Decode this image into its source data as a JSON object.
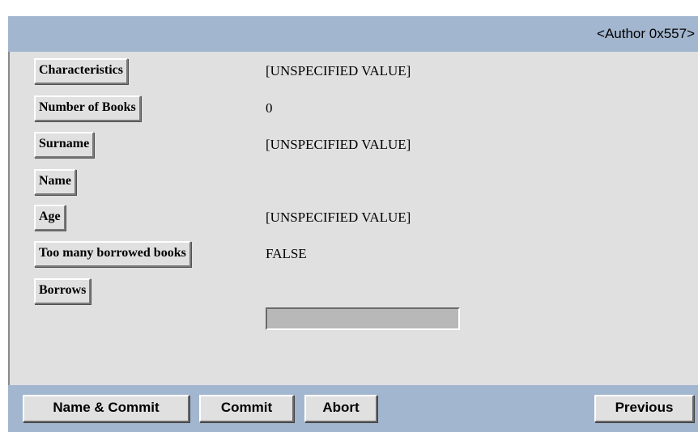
{
  "window": {
    "title": "<Author 0x557>"
  },
  "attributes": [
    {
      "label": "Characteristics",
      "value": "[UNSPECIFIED VALUE]"
    },
    {
      "label": "Number of Books",
      "value": "0"
    },
    {
      "label": "Surname",
      "value": "[UNSPECIFIED VALUE]"
    },
    {
      "label": "Name",
      "value": ""
    },
    {
      "label": "Age",
      "value": "[UNSPECIFIED VALUE]"
    },
    {
      "label": "Too many borrowed books",
      "value": "FALSE"
    },
    {
      "label": "Borrows",
      "value": ""
    }
  ],
  "actions": {
    "name_commit": "Name & Commit",
    "commit": "Commit",
    "abort": "Abort",
    "previous": "Previous"
  },
  "colors": {
    "bar_background": "#a3b6cf",
    "panel_background": "#e0e0e0"
  }
}
